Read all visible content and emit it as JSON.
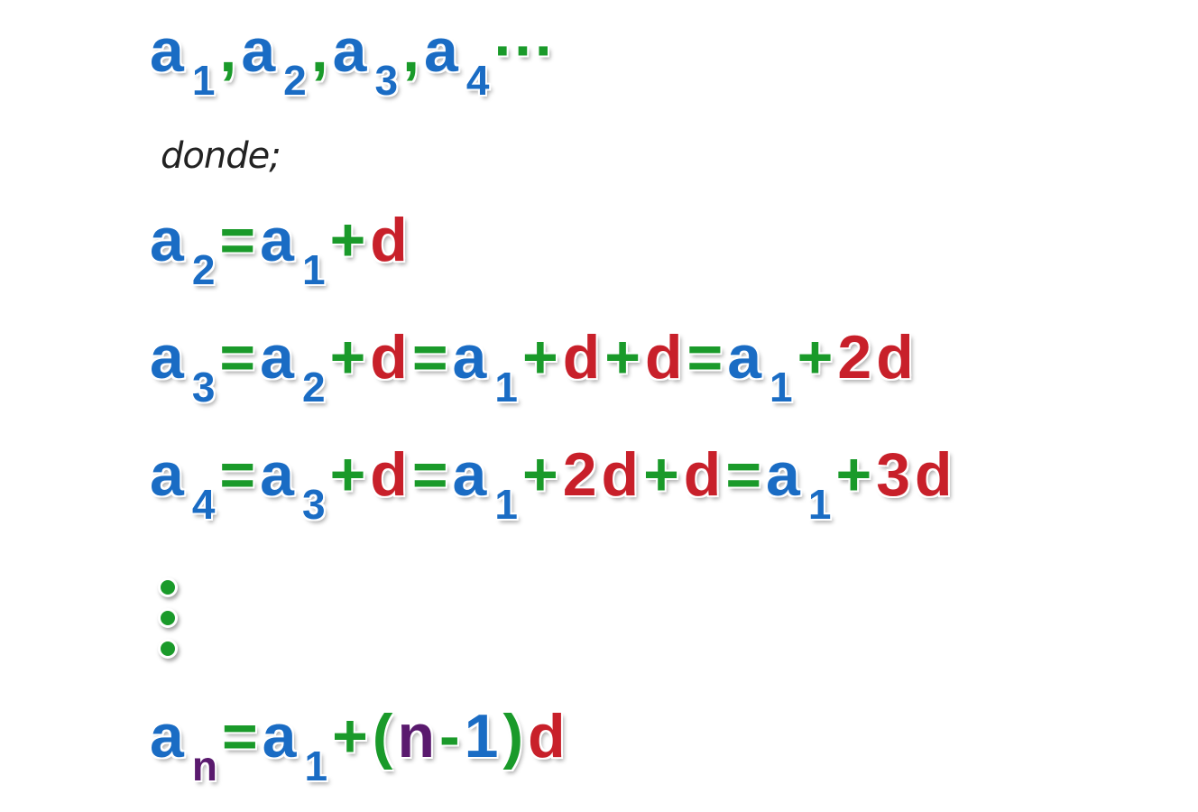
{
  "colors": {
    "blue": "#1a6cc4",
    "green": "#1a9a2a",
    "red": "#c8202a",
    "purple": "#5a1a6e"
  },
  "intro_word": "donde;",
  "icons": {
    "vertical_ellipsis": "vertical-dots"
  },
  "lines": [
    {
      "tokens": [
        {
          "t": "a",
          "c": "blue"
        },
        {
          "t": "1",
          "c": "blue",
          "sub": true
        },
        {
          "t": ",",
          "c": "green"
        },
        {
          "t": "a",
          "c": "blue"
        },
        {
          "t": "2",
          "c": "blue",
          "sub": true
        },
        {
          "t": ",",
          "c": "green"
        },
        {
          "t": "a",
          "c": "blue"
        },
        {
          "t": "3",
          "c": "blue",
          "sub": true
        },
        {
          "t": ",",
          "c": "green"
        },
        {
          "t": "a",
          "c": "blue"
        },
        {
          "t": "4",
          "c": "blue",
          "sub": true
        },
        {
          "t": "···",
          "c": "green"
        }
      ]
    },
    {
      "tokens": [
        {
          "t": "a",
          "c": "blue"
        },
        {
          "t": "2",
          "c": "blue",
          "sub": true
        },
        {
          "t": "=",
          "c": "green"
        },
        {
          "t": "a",
          "c": "blue"
        },
        {
          "t": "1",
          "c": "blue",
          "sub": true
        },
        {
          "t": "+",
          "c": "green"
        },
        {
          "t": "d",
          "c": "red"
        }
      ]
    },
    {
      "tokens": [
        {
          "t": "a",
          "c": "blue"
        },
        {
          "t": "3",
          "c": "blue",
          "sub": true
        },
        {
          "t": "=",
          "c": "green"
        },
        {
          "t": "a",
          "c": "blue"
        },
        {
          "t": "2",
          "c": "blue",
          "sub": true
        },
        {
          "t": "+",
          "c": "green"
        },
        {
          "t": "d",
          "c": "red"
        },
        {
          "t": "=",
          "c": "green"
        },
        {
          "t": "a",
          "c": "blue"
        },
        {
          "t": "1",
          "c": "blue",
          "sub": true
        },
        {
          "t": "+",
          "c": "green"
        },
        {
          "t": "d",
          "c": "red"
        },
        {
          "t": "+",
          "c": "green"
        },
        {
          "t": "d",
          "c": "red"
        },
        {
          "t": "=",
          "c": "green"
        },
        {
          "t": "a",
          "c": "blue"
        },
        {
          "t": "1",
          "c": "blue",
          "sub": true
        },
        {
          "t": "+",
          "c": "green"
        },
        {
          "t": "2",
          "c": "red"
        },
        {
          "t": "d",
          "c": "red"
        }
      ]
    },
    {
      "tokens": [
        {
          "t": "a",
          "c": "blue"
        },
        {
          "t": "4",
          "c": "blue",
          "sub": true
        },
        {
          "t": "=",
          "c": "green"
        },
        {
          "t": "a",
          "c": "blue"
        },
        {
          "t": "3",
          "c": "blue",
          "sub": true
        },
        {
          "t": "+",
          "c": "green"
        },
        {
          "t": "d",
          "c": "red"
        },
        {
          "t": "=",
          "c": "green"
        },
        {
          "t": "a",
          "c": "blue"
        },
        {
          "t": "1",
          "c": "blue",
          "sub": true
        },
        {
          "t": "+",
          "c": "green"
        },
        {
          "t": "2",
          "c": "red"
        },
        {
          "t": "d",
          "c": "red"
        },
        {
          "t": "+",
          "c": "green"
        },
        {
          "t": "d",
          "c": "red"
        },
        {
          "t": "=",
          "c": "green"
        },
        {
          "t": "a",
          "c": "blue"
        },
        {
          "t": "1",
          "c": "blue",
          "sub": true
        },
        {
          "t": "+",
          "c": "green"
        },
        {
          "t": "3",
          "c": "red"
        },
        {
          "t": "d",
          "c": "red"
        }
      ]
    },
    {
      "tokens": [
        {
          "t": "a",
          "c": "blue"
        },
        {
          "t": "n",
          "c": "purple",
          "sub": true
        },
        {
          "t": "=",
          "c": "green"
        },
        {
          "t": "a",
          "c": "blue"
        },
        {
          "t": "1",
          "c": "blue",
          "sub": true
        },
        {
          "t": "+",
          "c": "green"
        },
        {
          "t": "(",
          "c": "green"
        },
        {
          "t": "n",
          "c": "purple"
        },
        {
          "t": "-",
          "c": "green"
        },
        {
          "t": "1",
          "c": "blue"
        },
        {
          "t": ")",
          "c": "green"
        },
        {
          "t": "d",
          "c": "red"
        }
      ]
    }
  ]
}
